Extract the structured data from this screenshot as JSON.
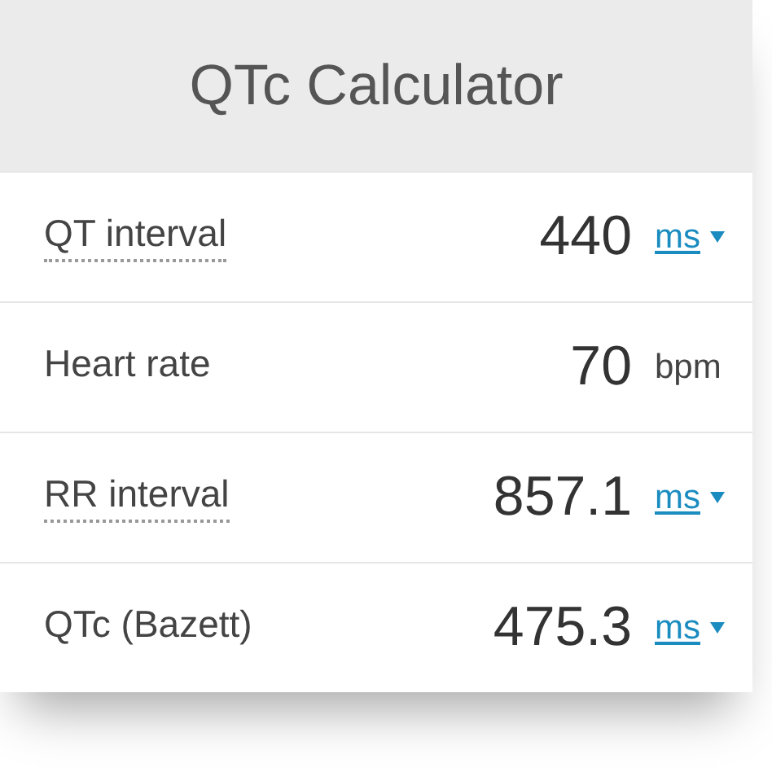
{
  "title": "QTc Calculator",
  "rows": [
    {
      "label": "QT interval",
      "dotted": true,
      "value": "440",
      "unit": {
        "kind": "dropdown",
        "text": "ms"
      }
    },
    {
      "label": "Heart rate",
      "dotted": false,
      "value": "70",
      "unit": {
        "kind": "plain",
        "text": "bpm"
      }
    },
    {
      "label": "RR interval",
      "dotted": true,
      "value": "857.1",
      "unit": {
        "kind": "dropdown",
        "text": "ms"
      }
    },
    {
      "label": "QTc (Bazett)",
      "dotted": false,
      "value": "475.3",
      "unit": {
        "kind": "dropdown",
        "text": "ms"
      }
    }
  ]
}
